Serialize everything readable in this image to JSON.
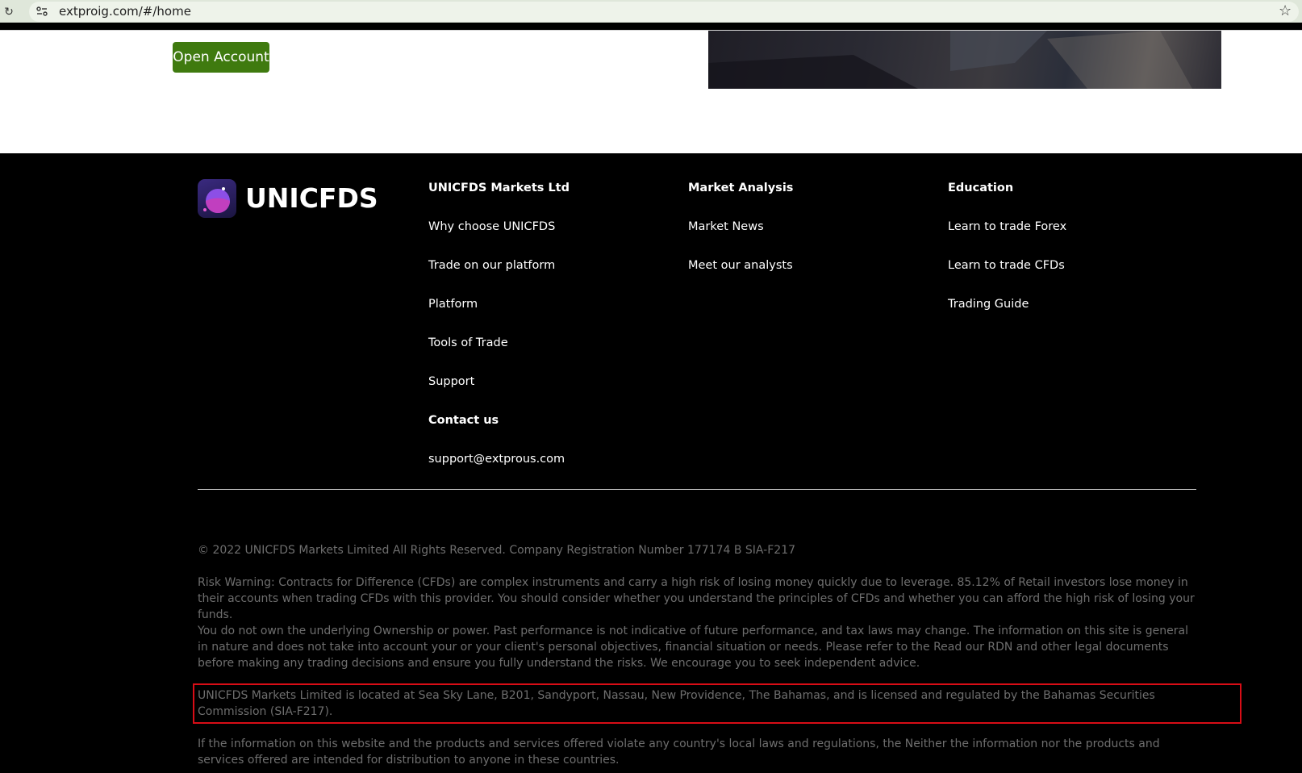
{
  "browser": {
    "url": "extproig.com/#/home",
    "reload_icon": "reload-icon",
    "site_info_icon": "site-info-icon",
    "bookmark_icon": "star-icon"
  },
  "hero": {
    "cta_label": "Open Account",
    "cta_color": "#3f7a0f"
  },
  "footer": {
    "brand": "UNICFDS",
    "columns": [
      {
        "heading": "UNICFDS Markets Ltd",
        "links": [
          "Why choose UNICFDS",
          "Trade on our platform",
          "Platform",
          "Tools of Trade",
          "Support"
        ],
        "contact_heading": "Contact us",
        "contact_email": "support@extprous.com"
      },
      {
        "heading": "Market Analysis",
        "links": [
          "Market News",
          "Meet our analysts"
        ]
      },
      {
        "heading": "Education",
        "links": [
          "Learn to trade Forex",
          "Learn to trade CFDs",
          "Trading Guide"
        ]
      }
    ],
    "copyright": "© 2022 UNICFDS Markets Limited All Rights Reserved. Company Registration Number 177174 B SIA-F217",
    "risk_warning": "Risk Warning: Contracts for Difference (CFDs) are complex instruments and carry a high risk of losing money quickly due to leverage. 85.12% of Retail investors lose money in their accounts when trading CFDs with this provider. You should consider whether you understand the principles of CFDs and whether you can afford the high risk of losing your funds.",
    "ownership_notice": "You do not own the underlying Ownership or power. Past performance is not indicative of future performance, and tax laws may change. The information on this site is general in nature and does not take into account your or your client's personal objectives, financial situation or needs. Please refer to the Read our RDN and other legal documents before making any trading decisions and ensure you fully understand the risks. We encourage you to seek independent advice.",
    "location_notice": "UNICFDS Markets Limited is located at Sea Sky Lane, B201, Sandyport, Nassau, New Providence, The Bahamas, and is licensed and regulated by the Bahamas Securities Commission (SIA-F217).",
    "jurisdiction_disclaimer": "If the information on this website and the products and services offered violate any country's local laws and regulations, the Neither the information nor the products and services offered are intended for distribution to anyone in these countries.",
    "highlight_color": "#d80d16"
  }
}
